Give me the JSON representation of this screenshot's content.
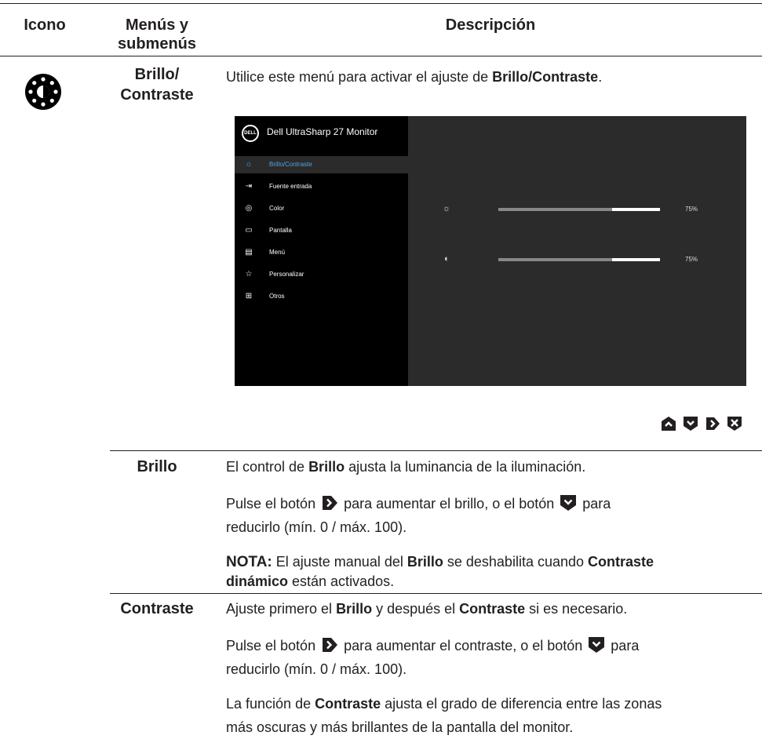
{
  "header": {
    "col1": "Icono",
    "col2_line1": "Menús y",
    "col2_line2": "submenús",
    "col3": "Descripción"
  },
  "section": {
    "name_line1": "Brillo/",
    "name_line2": "Contraste",
    "intro_pre": "Utilice este menú para activar el ajuste de ",
    "intro_bold": "Brillo/Contraste",
    "intro_post": "."
  },
  "osd": {
    "logo_text": "DELL",
    "title": "Dell UltraSharp 27 Monitor",
    "menu": [
      {
        "label": "Brillo/Contraste",
        "icon": "brightness-icon",
        "active": true
      },
      {
        "label": "Fuente entrada",
        "icon": "input-source-icon",
        "active": false
      },
      {
        "label": "Color",
        "icon": "color-icon",
        "active": false
      },
      {
        "label": "Pantalla",
        "icon": "display-icon",
        "active": false
      },
      {
        "label": "Menú",
        "icon": "menu-icon",
        "active": false
      },
      {
        "label": "Personalizar",
        "icon": "star-icon",
        "active": false
      },
      {
        "label": "Otros",
        "icon": "others-icon",
        "active": false
      }
    ],
    "brightness": {
      "value_text": "75%",
      "value": 75
    },
    "contrast": {
      "value_text": "75%",
      "value": 75
    }
  },
  "nav_buttons": [
    "up-button-icon",
    "down-button-icon",
    "right-button-icon",
    "exit-button-icon"
  ],
  "brillo": {
    "label": "Brillo",
    "p1_pre": "El control de ",
    "p1_bold": "Brillo",
    "p1_post": " ajusta la luminancia de la iluminación.",
    "p2_a": "Pulse el botón ",
    "p2_b": " para aumentar el brillo, o el botón ",
    "p2_c": " para",
    "p2_line2": "reducirlo (mín. 0 / máx. 100).",
    "note_label": "NOTA:",
    "note_a": " El ajuste manual del ",
    "note_b": "Brillo",
    "note_c": " se deshabilita cuando ",
    "note_d": "Contraste",
    "note_e": "dinámico",
    "note_f": " están activados."
  },
  "contraste": {
    "label": "Contraste",
    "p1_a": "Ajuste primero el ",
    "p1_b": "Brillo",
    "p1_c": " y después el ",
    "p1_d": "Contraste",
    "p1_e": " si es necesario.",
    "p2_a": "Pulse el botón ",
    "p2_b": " para aumentar el contraste, o el botón ",
    "p2_c": " para",
    "p2_line2": "reducirlo (mín. 0 / máx. 100).",
    "p3_a": "La función de ",
    "p3_b": "Contraste",
    "p3_c": " ajusta el grado de diferencia entre las zonas",
    "p3_line2": "más oscuras y más brillantes de la pantalla del monitor."
  }
}
